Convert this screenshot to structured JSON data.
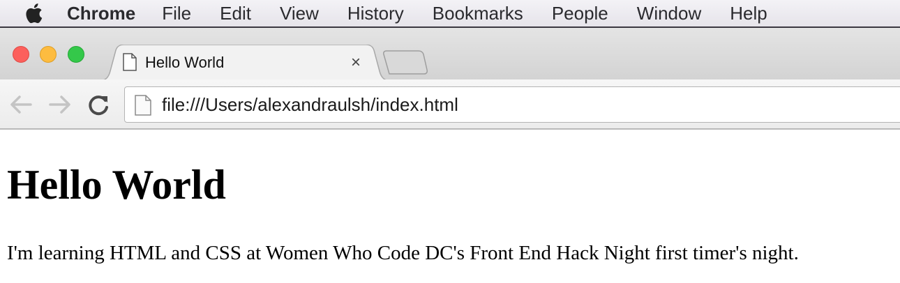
{
  "menubar": {
    "app_name": "Chrome",
    "items": [
      "File",
      "Edit",
      "View",
      "History",
      "Bookmarks",
      "People",
      "Window",
      "Help"
    ]
  },
  "tab": {
    "title": "Hello World",
    "close_glyph": "×"
  },
  "toolbar": {
    "url": "file:///Users/alexandraulsh/index.html"
  },
  "page": {
    "heading": "Hello World",
    "paragraph": "I'm learning HTML and CSS at Women Who Code DC's Front End Hack Night first timer's night."
  },
  "colors": {
    "traffic_close": "#fc605c",
    "traffic_minimize": "#fdbc40",
    "traffic_maximize": "#34c84a"
  }
}
